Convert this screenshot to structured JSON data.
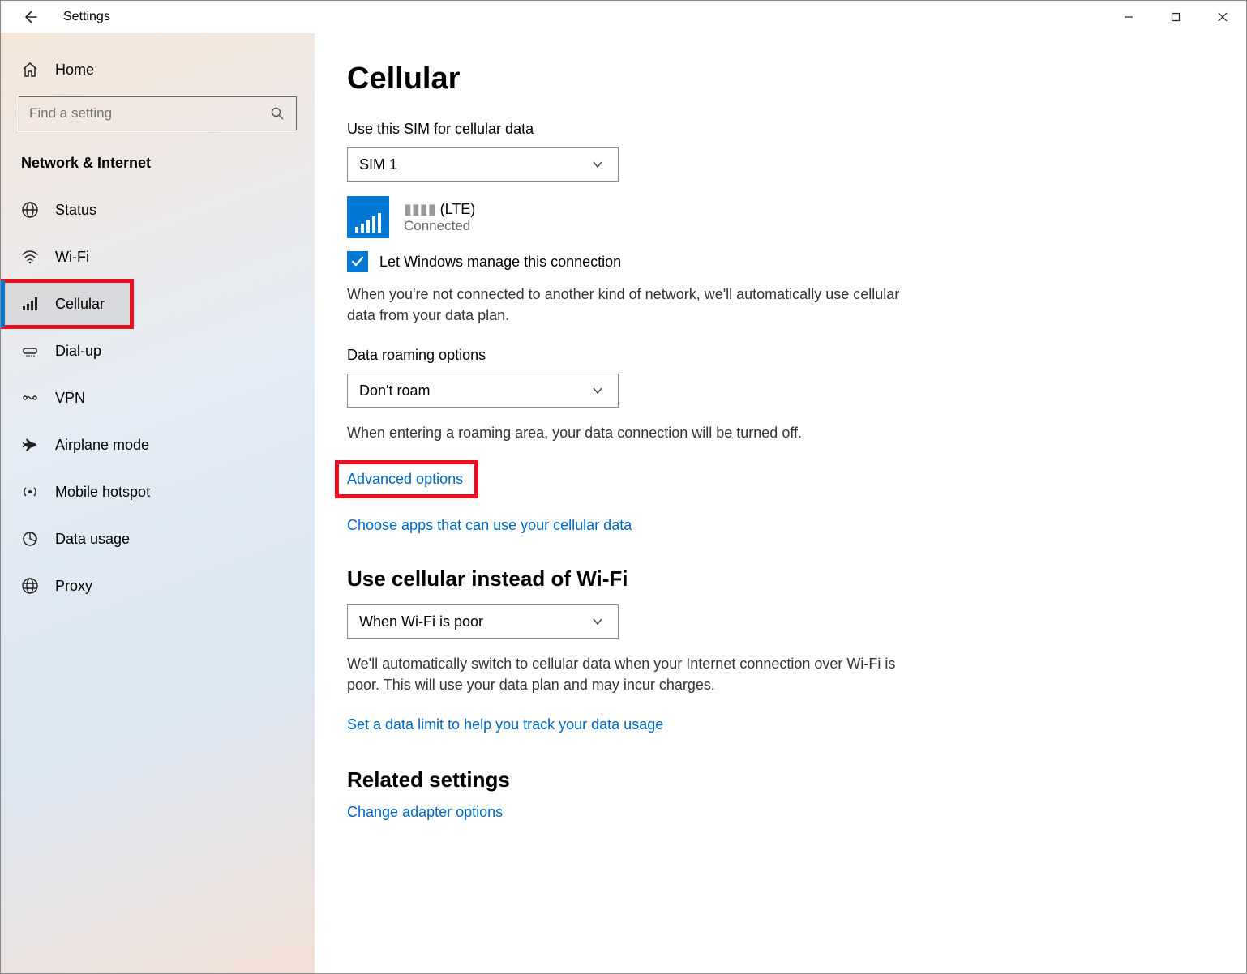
{
  "window": {
    "title": "Settings"
  },
  "sidebar": {
    "home": "Home",
    "search_placeholder": "Find a setting",
    "category": "Network & Internet",
    "items": [
      {
        "label": "Status"
      },
      {
        "label": "Wi-Fi"
      },
      {
        "label": "Cellular"
      },
      {
        "label": "Dial-up"
      },
      {
        "label": "VPN"
      },
      {
        "label": "Airplane mode"
      },
      {
        "label": "Mobile hotspot"
      },
      {
        "label": "Data usage"
      },
      {
        "label": "Proxy"
      }
    ]
  },
  "main": {
    "title": "Cellular",
    "sim_label": "Use this SIM for cellular data",
    "sim_select": "SIM 1",
    "network_suffix": " (LTE)",
    "network_status": "Connected",
    "manage_checkbox": "Let Windows manage this connection",
    "manage_desc": "When you're not connected to another kind of network, we'll automatically use cellular data from your data plan.",
    "roaming_label": "Data roaming options",
    "roaming_select": "Don't roam",
    "roaming_desc": "When entering a roaming area, your data connection will be turned off.",
    "advanced_link": "Advanced options",
    "choose_apps_link": "Choose apps that can use your cellular data",
    "use_cellular_heading": "Use cellular instead of Wi-Fi",
    "use_cellular_select": "When Wi-Fi is poor",
    "use_cellular_desc": "We'll automatically switch to cellular data when your Internet connection over Wi-Fi is poor. This will use your data plan and may incur charges.",
    "data_limit_link": "Set a data limit to help you track your data usage",
    "related_heading": "Related settings",
    "adapter_link": "Change adapter options"
  }
}
